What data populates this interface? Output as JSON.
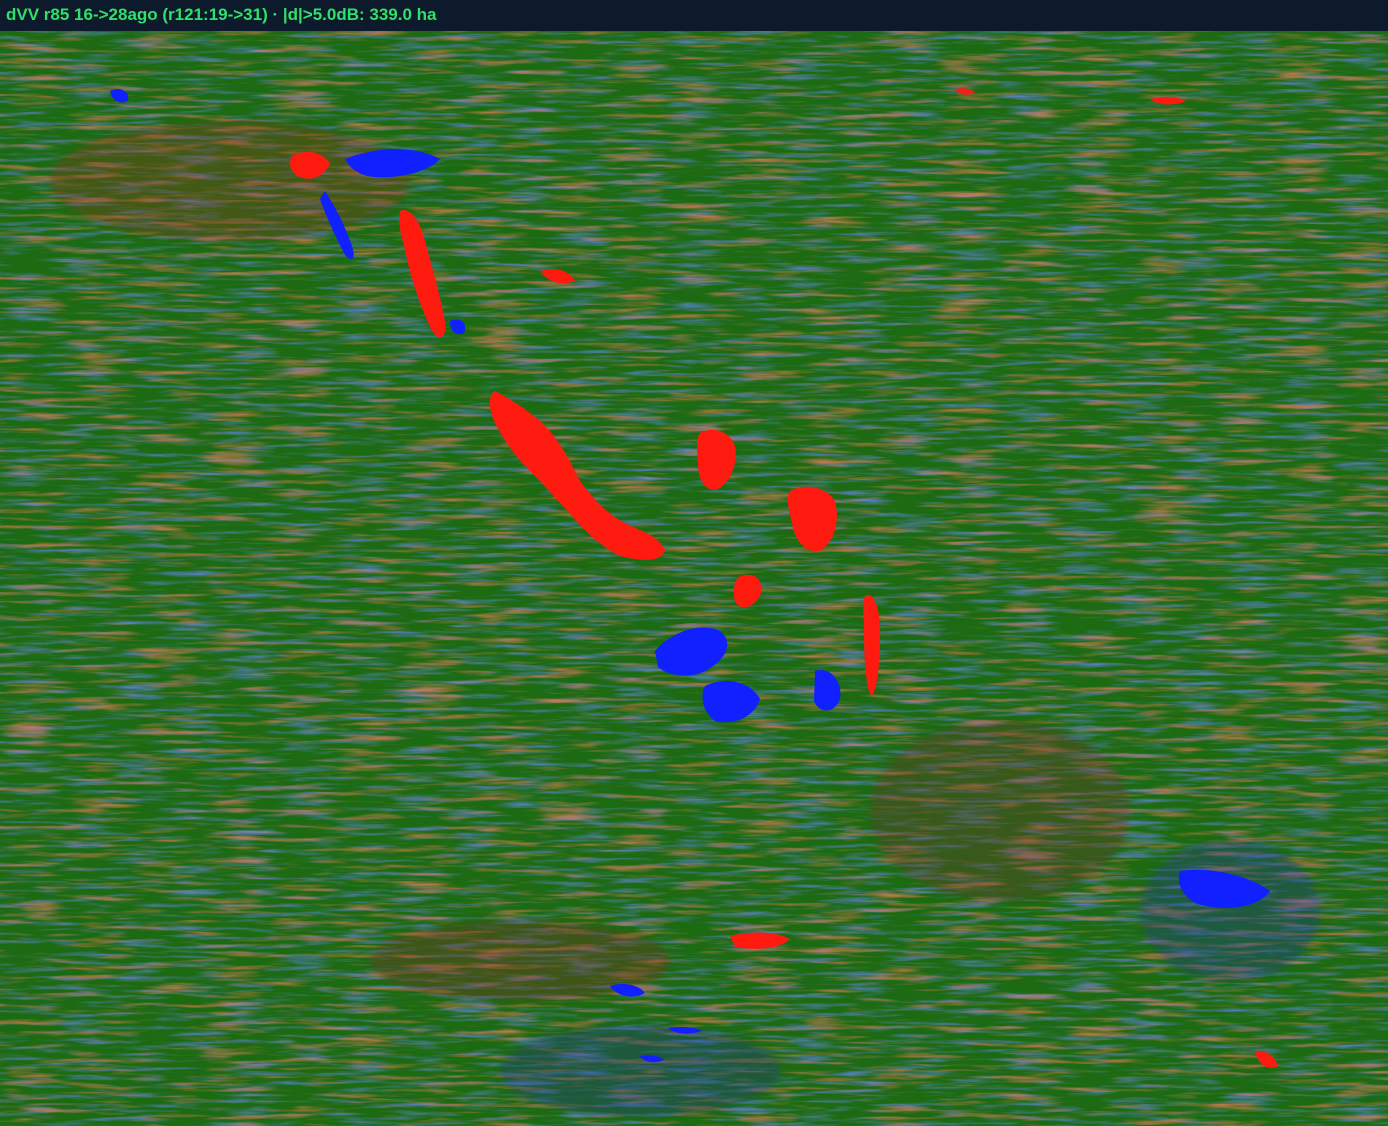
{
  "title_bar": {
    "text": "dVV r85 16->28ago (r121:19->31) · |d|>5.0dB: 339.0 ha"
  },
  "map": {
    "background_color": "#1c6a12",
    "increase_color": "#ff1a10",
    "decrease_color": "#1020ff",
    "title_color": "#2fe06a"
  }
}
